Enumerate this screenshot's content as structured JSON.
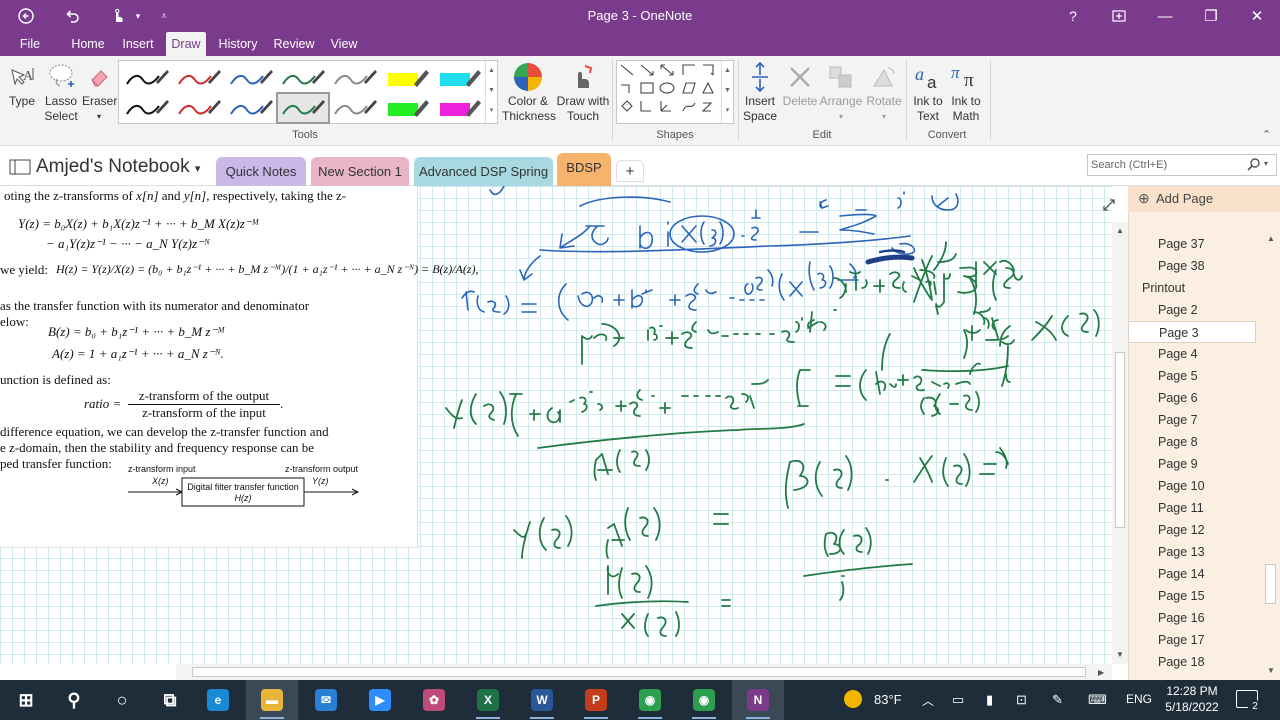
{
  "window": {
    "title": "Page 3 - OneNote",
    "help": "?",
    "controls": {
      "minimize": "—",
      "restore": "❐",
      "close": "✕",
      "fullscreen": "⛶"
    },
    "quick_access": [
      "back-icon",
      "undo-icon",
      "touch-mode-icon",
      "customize-icon"
    ]
  },
  "menu": {
    "tabs": [
      "File",
      "Home",
      "Insert",
      "Draw",
      "History",
      "Review",
      "View"
    ],
    "active": "Draw"
  },
  "ribbon": {
    "tools": {
      "type": "Type",
      "lasso": [
        "Lasso",
        "Select"
      ],
      "eraser": "Eraser",
      "group_label": "Tools",
      "pens": [
        {
          "color": "#111111",
          "style": "pen"
        },
        {
          "color": "#d42a2a",
          "style": "pen"
        },
        {
          "color": "#2b64b8",
          "style": "pen"
        },
        {
          "color": "#237a45",
          "style": "pen"
        },
        {
          "color": "#8a8a8a",
          "style": "pen"
        },
        {
          "color": "#ffff00",
          "style": "highlighter"
        },
        {
          "color": "#22ddee",
          "style": "highlighter"
        },
        {
          "color": "#111111",
          "style": "pen"
        },
        {
          "color": "#d42a2a",
          "style": "pen"
        },
        {
          "color": "#2b64b8",
          "style": "pen"
        },
        {
          "color": "#237a45",
          "style": "pen",
          "selected": true
        },
        {
          "color": "#8a8a8a",
          "style": "pen"
        },
        {
          "color": "#22ee22",
          "style": "highlighter"
        },
        {
          "color": "#ee22dd",
          "style": "highlighter"
        }
      ],
      "color_thickness": [
        "Color &",
        "Thickness"
      ],
      "draw_touch": [
        "Draw with",
        "Touch"
      ]
    },
    "shapes": {
      "group_label": "Shapes"
    },
    "edit": {
      "insert_space": [
        "Insert",
        "Space"
      ],
      "delete": "Delete",
      "arrange": "Arrange",
      "rotate": "Rotate",
      "group_label": "Edit"
    },
    "convert": {
      "ink_to_text": [
        "Ink to",
        "Text"
      ],
      "ink_to_math": [
        "Ink to",
        "Math"
      ],
      "group_label": "Convert"
    },
    "collapse": "⌃"
  },
  "notebook": {
    "name": "Amjed's Notebook",
    "sections": [
      {
        "label": "Quick Notes",
        "color": "#c9b8e8"
      },
      {
        "label": "New Section 1",
        "color": "#e8b4c8"
      },
      {
        "label": "Advanced DSP Spring",
        "color": "#a8d8e0"
      },
      {
        "label": "BDSP",
        "color": "#f5b36b",
        "active": true
      }
    ],
    "add_section": "+",
    "search_placeholder": "Search (Ctrl+E)"
  },
  "printout": {
    "line1_a": "oting the z-transforms of ",
    "line1_b": "x[n]",
    "line1_c": " and ",
    "line1_d": "y[n]",
    "line1_e": ", respectively, taking the z-",
    "eq_y1": "Y(z) = b₀X(z) + b₁X(z)z⁻¹ + ··· + b_M X(z)z⁻ᴹ",
    "eq_y2": "− a₁Y(z)z⁻¹ − ··· − a_N Y(z)z⁻ᴺ",
    "we_yield": "we yield:",
    "eq_h": "H(z) = Y(z)/X(z) = (b₀ + b₁z⁻¹ + ··· + b_M z⁻ᴹ)/(1 + a₁z⁻¹ + ··· + a_N z⁻ᴺ) = B(z)/A(z),",
    "line_tf": "as the transfer function with its numerator and denominator",
    "line_below": "elow:",
    "eq_b": "B(z) = b₀ + b₁z⁻¹ + ··· + b_M z⁻ᴹ",
    "eq_a": "A(z) = 1 + a₁z⁻¹ + ··· + a_N z⁻ᴺ.",
    "line_fn": "unction is defined as:",
    "ratio_lhs": "ratio =",
    "ratio_num": "z-transform of the output",
    "ratio_den": "z-transform of the input",
    "ratio_dot": ".",
    "line_diff1": "difference equation, we can develop the z-transfer function and",
    "line_diff2": "e z-domain, then the stability and frequency response can be",
    "line_diff3": "ped transfer function:",
    "block": {
      "input_label": "z-transform input",
      "input_var": "X(z)",
      "box_line1": "Digital filter transfer function",
      "box_line2": "H(z)",
      "output_label": "z-transform output",
      "output_var": "Y(z)"
    }
  },
  "pages": {
    "add_page": "Add Page",
    "items": [
      {
        "label": "Page 37",
        "indent": true
      },
      {
        "label": "Page 38",
        "indent": true
      },
      {
        "label": "Printout",
        "indent": false
      },
      {
        "label": "Page 2",
        "indent": true
      },
      {
        "label": "Page 3",
        "indent": true,
        "selected": true
      },
      {
        "label": "Page 4",
        "indent": true
      },
      {
        "label": "Page 5",
        "indent": true
      },
      {
        "label": "Page 6",
        "indent": true
      },
      {
        "label": "Page 7",
        "indent": true
      },
      {
        "label": "Page 8",
        "indent": true
      },
      {
        "label": "Page 9",
        "indent": true
      },
      {
        "label": "Page 10",
        "indent": true
      },
      {
        "label": "Page 11",
        "indent": true
      },
      {
        "label": "Page 12",
        "indent": true
      },
      {
        "label": "Page 13",
        "indent": true
      },
      {
        "label": "Page 14",
        "indent": true
      },
      {
        "label": "Page 15",
        "indent": true
      },
      {
        "label": "Page 16",
        "indent": true
      },
      {
        "label": "Page 17",
        "indent": true
      },
      {
        "label": "Page 18",
        "indent": true
      }
    ]
  },
  "taskbar": {
    "apps": [
      {
        "name": "start",
        "glyph": "⊞",
        "color": "#1f2c39"
      },
      {
        "name": "search",
        "glyph": "⚲",
        "color": "#1f2c39"
      },
      {
        "name": "cortana",
        "glyph": "○",
        "color": "#1f2c39"
      },
      {
        "name": "task-view",
        "glyph": "⧉",
        "color": "#1f2c39"
      },
      {
        "name": "edge",
        "glyph": "e",
        "color": "#1a8ad4"
      },
      {
        "name": "file-explorer",
        "glyph": "▬",
        "color": "#e9b43a"
      },
      {
        "name": "mail",
        "glyph": "✉",
        "color": "#2a7fd4"
      },
      {
        "name": "zoom",
        "glyph": "▶",
        "color": "#2d8cff"
      },
      {
        "name": "paint",
        "glyph": "✿",
        "color": "#c04a7a"
      },
      {
        "name": "excel",
        "glyph": "X",
        "color": "#1e7145"
      },
      {
        "name": "word",
        "glyph": "W",
        "color": "#2b579a"
      },
      {
        "name": "powerpoint",
        "glyph": "P",
        "color": "#c43e1c"
      },
      {
        "name": "chrome",
        "glyph": "◉",
        "color": "#2e9e4f"
      },
      {
        "name": "chrome-profile",
        "glyph": "◉",
        "color": "#2e9e4f"
      },
      {
        "name": "onenote",
        "glyph": "N",
        "color": "#7a3b8c"
      }
    ],
    "weather": "83°F",
    "language": "ENG",
    "time": "12:28 PM",
    "date": "5/18/2022",
    "notifications": "2"
  }
}
